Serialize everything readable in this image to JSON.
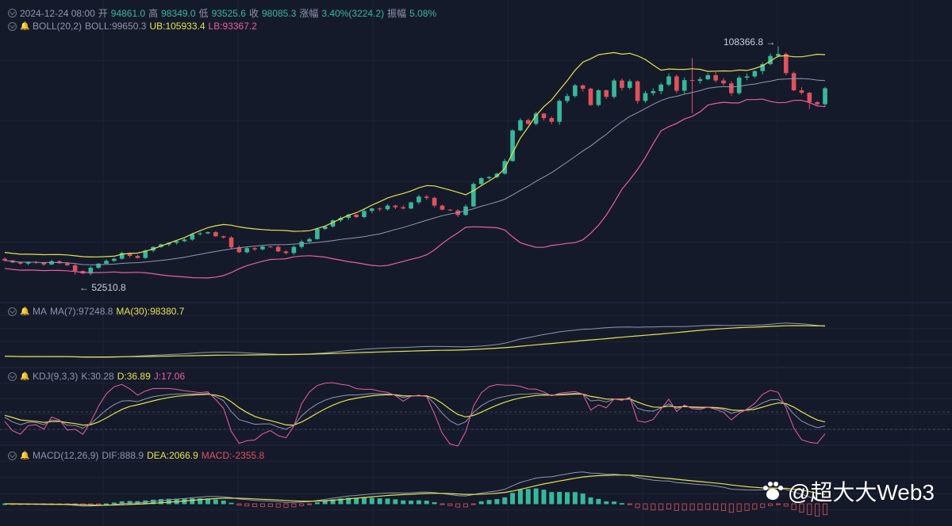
{
  "header": {
    "date": "2024-12-24 08:00",
    "open_label": "开",
    "open": "94861.0",
    "high_label": "高",
    "high": "98349.0",
    "low_label": "低",
    "low": "93525.6",
    "close_label": "收",
    "close": "98085.3",
    "change_label": "涨幅",
    "change": "3.40%(3224.2)",
    "amp_label": "振幅",
    "amp": "5.08%"
  },
  "boll": {
    "title": "BOLL(20,2)",
    "boll": "BOLL:99650.3",
    "ub": "UB:105933.4",
    "lb": "LB:93367.2"
  },
  "ma": {
    "title": "MA",
    "ma7": "MA(7):97248.8",
    "ma30": "MA(30):98380.7"
  },
  "kdj": {
    "title": "KDJ(9,3,3)",
    "k": "K:30.28",
    "d": "D:36.89",
    "j": "J:17.06"
  },
  "macd": {
    "title": "MACD(12,26,9)",
    "dif": "DIF:888.9",
    "dea": "DEA:2066.9",
    "macd": "MACD:-2355.8"
  },
  "annotations": {
    "high": "108366.8 →",
    "low": "← 52510.8"
  },
  "watermark": "@超大大Web3",
  "colors": {
    "bg": "#151a2b",
    "up": "#37b89a",
    "down": "#e0525b",
    "ub": "#e6e24a",
    "lb": "#e85fa0",
    "mid": "#8f98b0"
  },
  "chart_data": {
    "type": "candlestick",
    "closes": [
      56000,
      55500,
      55200,
      55600,
      55400,
      55000,
      55800,
      55300,
      54800,
      53400,
      52800,
      54200,
      55200,
      55900,
      56400,
      57800,
      57100,
      56600,
      58400,
      59300,
      59900,
      60300,
      60700,
      61100,
      62400,
      62600,
      62900,
      61900,
      61600,
      59200,
      58000,
      59000,
      58700,
      59400,
      59300,
      58200,
      57800,
      59300,
      60600,
      61200,
      63700,
      64300,
      65800,
      66400,
      67200,
      66600,
      68100,
      68700,
      68500,
      69400,
      69000,
      68700,
      70200,
      71600,
      71300,
      69400,
      68400,
      68200,
      67100,
      69200,
      74700,
      76100,
      76400,
      77200,
      80300,
      87800,
      90300,
      89400,
      91900,
      90800,
      89900,
      95000,
      96200,
      98800,
      98000,
      94000,
      97600,
      96000,
      100000,
      98200,
      99800,
      95000,
      96900,
      97400,
      99000,
      101000,
      97500,
      100100,
      99900,
      100300,
      101300,
      100000,
      99300,
      96900,
      100700,
      101000,
      102300,
      104000,
      106000,
      106500,
      101800,
      97600,
      97000,
      94700,
      94200,
      98100
    ],
    "high": "108366.8",
    "low": "52510.8",
    "boll": {
      "mid": "99650.3",
      "ub": "105933.4",
      "lb": "93367.2"
    },
    "ma7": "97248.8",
    "ma30": "98380.7",
    "kdj": {
      "k": "30.28",
      "d": "36.89",
      "j": "17.06"
    },
    "macd": {
      "dif": "888.9",
      "dea": "2066.9",
      "hist": "-2355.8"
    }
  }
}
